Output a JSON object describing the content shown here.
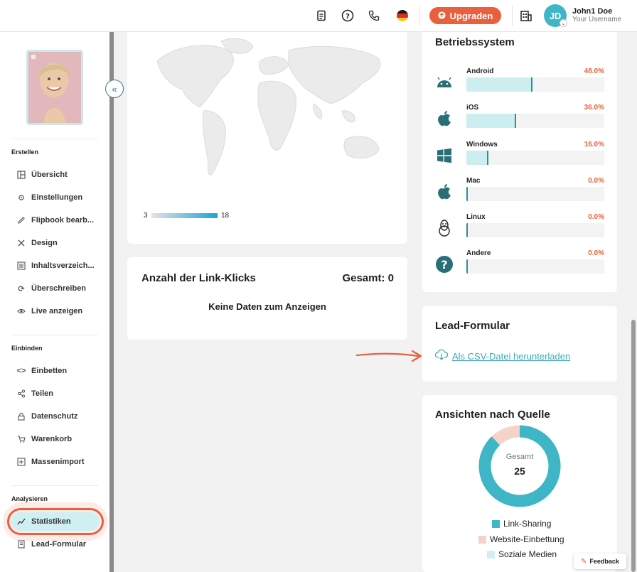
{
  "header": {
    "upgrade_label": "Upgraden",
    "user_initials": "JD",
    "user_name": "John1 Doe",
    "user_sub": "Your Username"
  },
  "sidebar": {
    "sections": {
      "create": "Erstellen",
      "embed": "Einbinden",
      "analyze": "Analysieren"
    },
    "items": [
      {
        "label": "Übersicht",
        "icon": "layout-icon"
      },
      {
        "label": "Einstellungen",
        "icon": "gear-icon"
      },
      {
        "label": "Flipbook bearb...",
        "icon": "pencil-icon"
      },
      {
        "label": "Design",
        "icon": "tools-icon"
      },
      {
        "label": "Inhaltsverzeich...",
        "icon": "list-icon"
      },
      {
        "label": "Überschreiben",
        "icon": "refresh-icon"
      },
      {
        "label": "Live anzeigen",
        "icon": "eye-icon"
      },
      {
        "label": "Einbetten",
        "icon": "code-icon"
      },
      {
        "label": "Teilen",
        "icon": "share-icon"
      },
      {
        "label": "Datenschutz",
        "icon": "lock-icon"
      },
      {
        "label": "Warenkorb",
        "icon": "cart-icon"
      },
      {
        "label": "Massenimport",
        "icon": "import-icon"
      },
      {
        "label": "Statistiken",
        "icon": "chart-icon"
      },
      {
        "label": "Lead-Formular",
        "icon": "form-icon"
      }
    ]
  },
  "map": {
    "legend_min": "3",
    "legend_max": "18"
  },
  "link_clicks": {
    "title": "Anzahl der Link-Klicks",
    "total": "Gesamt: 0",
    "empty": "Keine Daten zum Anzeigen"
  },
  "os": {
    "title": "Betriebssystem",
    "rows": [
      {
        "name": "Android",
        "pct": "48.0%",
        "value": 48.0,
        "icon": "android-icon"
      },
      {
        "name": "iOS",
        "pct": "36.0%",
        "value": 36.0,
        "icon": "apple-icon"
      },
      {
        "name": "Windows",
        "pct": "16.0%",
        "value": 16.0,
        "icon": "windows-icon"
      },
      {
        "name": "Mac",
        "pct": "0.0%",
        "value": 0.0,
        "icon": "apple-icon"
      },
      {
        "name": "Linux",
        "pct": "0.0%",
        "value": 0.0,
        "icon": "linux-icon"
      },
      {
        "name": "Andere",
        "pct": "0.0%",
        "value": 0.0,
        "icon": "question-icon"
      }
    ]
  },
  "lead_form": {
    "title": "Lead-Formular",
    "download_label": "Als CSV-Datei herunterladen"
  },
  "source_views": {
    "title": "Ansichten nach Quelle",
    "center_label": "Gesamt",
    "center_value": "25",
    "legend": [
      {
        "name": "Link-Sharing",
        "color": "#3fb6c6"
      },
      {
        "name": "Website-Einbettung",
        "color": "#f6d3c9"
      },
      {
        "name": "Soziale Medien",
        "color": "#d3eef2"
      }
    ]
  },
  "chart_data": {
    "type": "pie",
    "categories": [
      "Link-Sharing",
      "Website-Einbettung",
      "Soziale Medien"
    ],
    "values": [
      22,
      3,
      0
    ],
    "title": "Ansichten nach Quelle"
  },
  "feedback_label": "Feedback",
  "colors": {
    "accent": "#e8603c",
    "teal": "#3fb6c6",
    "dark_teal": "#2a6f76"
  }
}
